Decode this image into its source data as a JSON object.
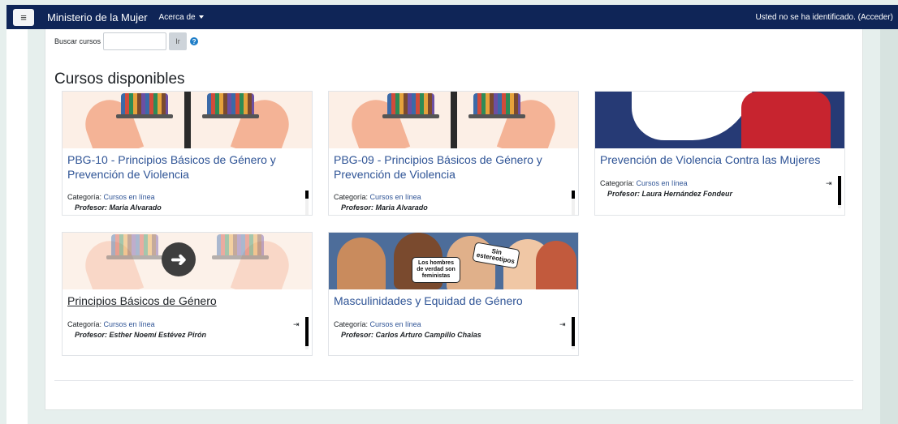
{
  "navbar": {
    "menu_icon": "hamburger-icon",
    "brand": "Ministerio de la Mujer",
    "acerca": "Acerca de",
    "login_text": "Usted no se ha identificado. (Acceder)"
  },
  "search": {
    "label": "Buscar cursos",
    "value": "",
    "button": "Ir",
    "help": "?"
  },
  "section_title": "Cursos disponibles",
  "courses": [
    {
      "title": "PBG-10 - Principios Básicos de Género y Prevención de Violencia",
      "category_label": "Categoría:",
      "category": "Cursos en línea",
      "professor": "Profesor: Maria Alvarado",
      "image": "scale-hands"
    },
    {
      "title": "PBG-09 - Principios Básicos de Género y Prevención de Violencia",
      "category_label": "Categoría:",
      "category": "Cursos en línea",
      "professor": "Profesor: Maria Alvarado",
      "image": "scale-hands"
    },
    {
      "title": "Prevención de Violencia Contra las Mujeres",
      "category_label": "Categoría:",
      "category": "Cursos en línea",
      "professor": "Profesor: Laura Hernández Fondeur",
      "image": "fist-face",
      "enter_icon": "sign-in-icon"
    },
    {
      "title": "Principios Básicos de Género",
      "category_label": "Categoría:",
      "category": "Cursos en línea",
      "professor": "Profesor: Esther Noemí Estévez Pirón",
      "image": "scale-hands-arrow",
      "enter_icon": "sign-in-icon"
    },
    {
      "title": "Masculinidades y Equidad de Género",
      "category_label": "Categoría:",
      "category": "Cursos en línea",
      "professor": "Profesor: Carlos Arturo Campillo Chalas",
      "image": "cartoon-men",
      "enter_icon": "sign-in-icon",
      "bubble_left": "Los hombres de verdad son feministas",
      "bubble_right": "Sin estereotipos"
    }
  ]
}
